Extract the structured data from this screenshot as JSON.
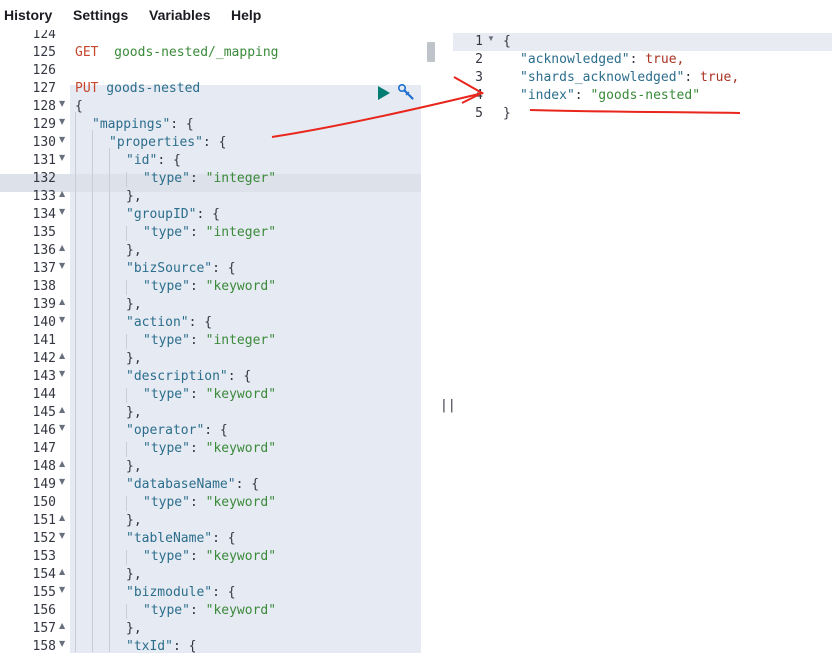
{
  "menu": {
    "history": "History",
    "settings": "Settings",
    "variables": "Variables",
    "help": "Help"
  },
  "editor": {
    "request_lines": [
      {
        "n": "124",
        "text": ""
      },
      {
        "n": "125",
        "method": "GET",
        "path": "goods-nested/_mapping"
      },
      {
        "n": "126",
        "text": ""
      },
      {
        "n": "127",
        "method": "PUT",
        "path": "goods-nested"
      },
      {
        "n": "128",
        "text": "{"
      },
      {
        "n": "129",
        "text": "\"mappings\": {"
      },
      {
        "n": "130",
        "text": "\"properties\": {"
      },
      {
        "n": "131",
        "text": "\"id\": {"
      },
      {
        "n": "132",
        "text": "\"type\": \"integer\""
      },
      {
        "n": "133",
        "text": "},"
      },
      {
        "n": "134",
        "text": "\"groupID\": {"
      },
      {
        "n": "135",
        "text": "\"type\": \"integer\""
      },
      {
        "n": "136",
        "text": "},"
      },
      {
        "n": "137",
        "text": "\"bizSource\": {"
      },
      {
        "n": "138",
        "text": "\"type\": \"keyword\""
      },
      {
        "n": "139",
        "text": "},"
      },
      {
        "n": "140",
        "text": "\"action\": {"
      },
      {
        "n": "141",
        "text": "\"type\": \"integer\""
      },
      {
        "n": "142",
        "text": "},"
      },
      {
        "n": "143",
        "text": "\"description\": {"
      },
      {
        "n": "144",
        "text": "\"type\": \"keyword\""
      },
      {
        "n": "145",
        "text": "},"
      },
      {
        "n": "146",
        "text": "\"operator\": {"
      },
      {
        "n": "147",
        "text": "\"type\": \"keyword\""
      },
      {
        "n": "148",
        "text": "},"
      },
      {
        "n": "149",
        "text": "\"databaseName\": {"
      },
      {
        "n": "150",
        "text": "\"type\": \"keyword\""
      },
      {
        "n": "151",
        "text": "},"
      },
      {
        "n": "152",
        "text": "\"tableName\": {"
      },
      {
        "n": "153",
        "text": "\"type\": \"keyword\""
      },
      {
        "n": "154",
        "text": "},"
      },
      {
        "n": "155",
        "text": "\"bizmodule\": {"
      },
      {
        "n": "156",
        "text": "\"type\": \"keyword\""
      },
      {
        "n": "157",
        "text": "},"
      },
      {
        "n": "158",
        "text": "\"txId\": {"
      }
    ]
  },
  "output": {
    "lines": [
      {
        "n": "1",
        "text": "{"
      },
      {
        "n": "2",
        "key": "\"acknowledged\"",
        "value": "true,"
      },
      {
        "n": "3",
        "key": "\"shards_acknowledged\"",
        "value": "true,"
      },
      {
        "n": "4",
        "key": "\"index\"",
        "value": "\"goods-nested\""
      },
      {
        "n": "5",
        "text": "}"
      }
    ]
  },
  "icons": {
    "run": "play-triangle",
    "settings": "wrench"
  },
  "colors": {
    "annotation": "#e8261c",
    "key": "#2c6e8c",
    "string": "#3a8a3a",
    "method": "#c6462e",
    "boolean": "#a32",
    "request_bg": "#e6eaf2"
  },
  "splitter_label": "||"
}
